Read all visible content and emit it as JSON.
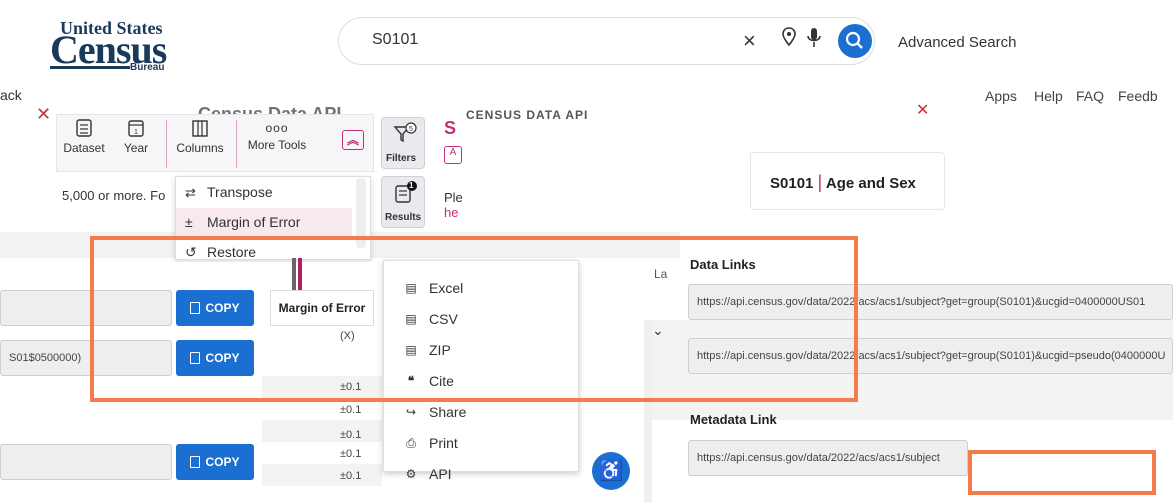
{
  "header": {
    "logo_top": "United States",
    "logo_main": "Census",
    "logo_bureau": "Bureau",
    "search_value": "S0101",
    "advanced_search": "Advanced Search"
  },
  "nav": {
    "back": "ack",
    "items": [
      "Apps",
      "Help",
      "FAQ",
      "Feedb"
    ]
  },
  "dialog": {
    "title": "Census Data API",
    "blur_text": "CENSUS DATA API"
  },
  "toolbar": {
    "dataset": "Dataset",
    "year": "Year",
    "columns": "Columns",
    "more_tools": "More Tools",
    "more_dots": "ooo",
    "filters": "Filters",
    "results": "Results",
    "results_badge": "1"
  },
  "notice": "5,000 or more. Fo",
  "right_snippets": {
    "s": "S",
    "chip": "A",
    "ple": "Ple",
    "he": "he"
  },
  "more_tools_menu": {
    "items": [
      "Transpose",
      "Margin of Error",
      "Restore"
    ]
  },
  "card": {
    "code": "S0101",
    "separator": "|",
    "label": "Age and Sex"
  },
  "table": {
    "column_header": "Margin of Error",
    "copy_label": "COPY",
    "row_fields": [
      "",
      "S01$0500000)",
      ""
    ],
    "moe_values": [
      "(X)",
      "±0.1",
      "±0.1",
      "±0.1",
      "±0.1",
      "±0.1"
    ]
  },
  "download_menu": {
    "items": [
      {
        "label": "Excel",
        "icon": "excel-icon"
      },
      {
        "label": "CSV",
        "icon": "csv-icon"
      },
      {
        "label": "ZIP",
        "icon": "zip-icon"
      },
      {
        "label": "Cite",
        "icon": "cite-icon"
      },
      {
        "label": "Share",
        "icon": "share-icon"
      },
      {
        "label": "Print",
        "icon": "print-icon"
      },
      {
        "label": "API",
        "icon": "api-icon"
      }
    ]
  },
  "right_panel": {
    "la": "La",
    "data_links_title": "Data Links",
    "data_links": [
      "https://api.census.gov/data/2022/acs/acs1/subject?get=group(S0101)&ucgid=0400000US01",
      "https://api.census.gov/data/2022/acs/acs1/subject?get=group(S0101)&ucgid=pseudo(0400000U"
    ],
    "metadata_title": "Metadata Link",
    "metadata_link": "https://api.census.gov/data/2022/acs/acs1/subject"
  },
  "colors": {
    "accent": "#1a6fd1",
    "highlight": "#f47c4a",
    "brand": "#c43078"
  }
}
